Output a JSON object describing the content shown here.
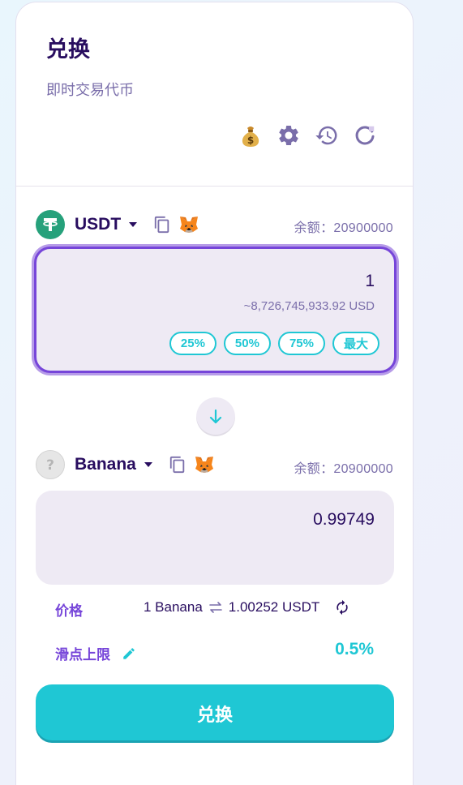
{
  "header": {
    "title": "兑换",
    "subtitle": "即时交易代币"
  },
  "tools": {
    "icons": [
      "money-bag-icon",
      "gear-icon",
      "history-icon",
      "refresh-icon"
    ]
  },
  "from": {
    "token": "USDT",
    "balance": "余额：20900000",
    "amount": "1",
    "usd_value": "~8,726,745,933.92 USD",
    "percent_buttons": [
      "25%",
      "50%",
      "75%",
      "最大"
    ]
  },
  "to": {
    "token": "Banana",
    "balance": "余额：20900000",
    "amount": "0.99749"
  },
  "price": {
    "label": "价格",
    "left": "1 Banana",
    "right": "1.00252 USDT"
  },
  "slippage": {
    "label": "滑点上限",
    "value": "0.5%"
  },
  "swap_button": "兑换",
  "colors": {
    "primary": "#1fc7d4",
    "secondary": "#7645d9",
    "text": "#280d5f",
    "text_subtle": "#7a6eaa",
    "input_bg": "#eeeaf4"
  }
}
